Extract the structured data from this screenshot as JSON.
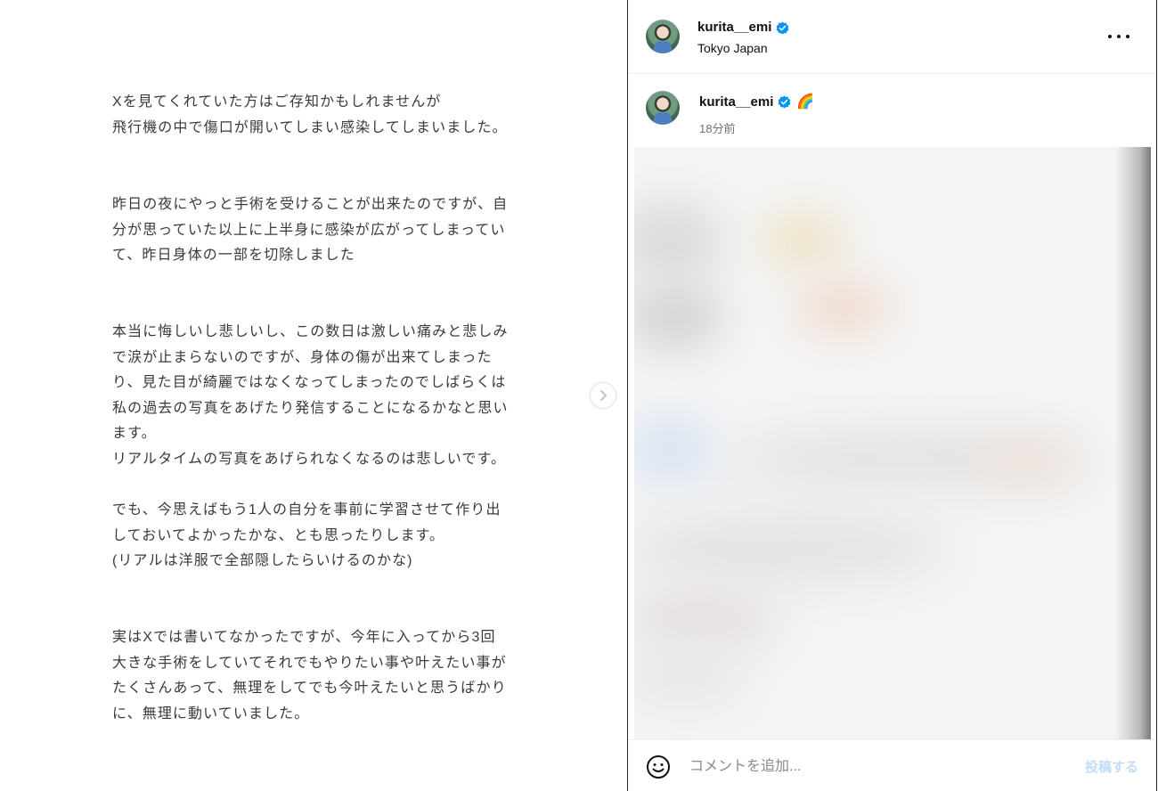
{
  "article": {
    "paragraphs": [
      [
        "Xを見てくれていた方はご存知かもしれませんが",
        "飛行機の中で傷口が開いてしまい感染してしまいました。"
      ],
      [
        "昨日の夜にやっと手術を受けることが出来たのですが、自",
        "分が思っていた以上に上半身に感染が広がってしまってい",
        "て、昨日身体の一部を切除しました"
      ],
      [
        "本当に悔しいし悲しいし、この数日は激しい痛みと悲しみ",
        "で涙が止まらないのですが、身体の傷が出来てしまった",
        "り、見た目が綺麗ではなくなってしまったのでしばらくは",
        "私の過去の写真をあげたり発信することになるかなと思い",
        "ます。",
        "リアルタイムの写真をあげられなくなるのは悲しいです。"
      ],
      [
        "でも、今思えばもう1人の自分を事前に学習させて作り出",
        "しておいてよかったかな、とも思ったりします。",
        "(リアルは洋服で全部隠したらいけるのかな)"
      ],
      [
        "実はXでは書いてなかったですが、今年に入ってから3回",
        "大きな手術をしていてそれでもやりたい事や叶えたい事が",
        "たくさんあって、無理をしてでも今叶えたいと思うばかり",
        "に、無理に動いていました。"
      ]
    ]
  },
  "header": {
    "username": "kurita__emi",
    "location": "Tokyo Japan"
  },
  "caption": {
    "username": "kurita__emi",
    "emoji": "🌈",
    "time": "18分前"
  },
  "footer": {
    "placeholder": "コメントを追加...",
    "post_label": "投稿する"
  },
  "colors": {
    "verified": "#0095f6",
    "post_disabled": "#c3dcf7",
    "text": "#3a3a3a"
  },
  "icons": [
    "chevron-right-icon",
    "verified-icon",
    "more-icon",
    "emoji-icon"
  ]
}
